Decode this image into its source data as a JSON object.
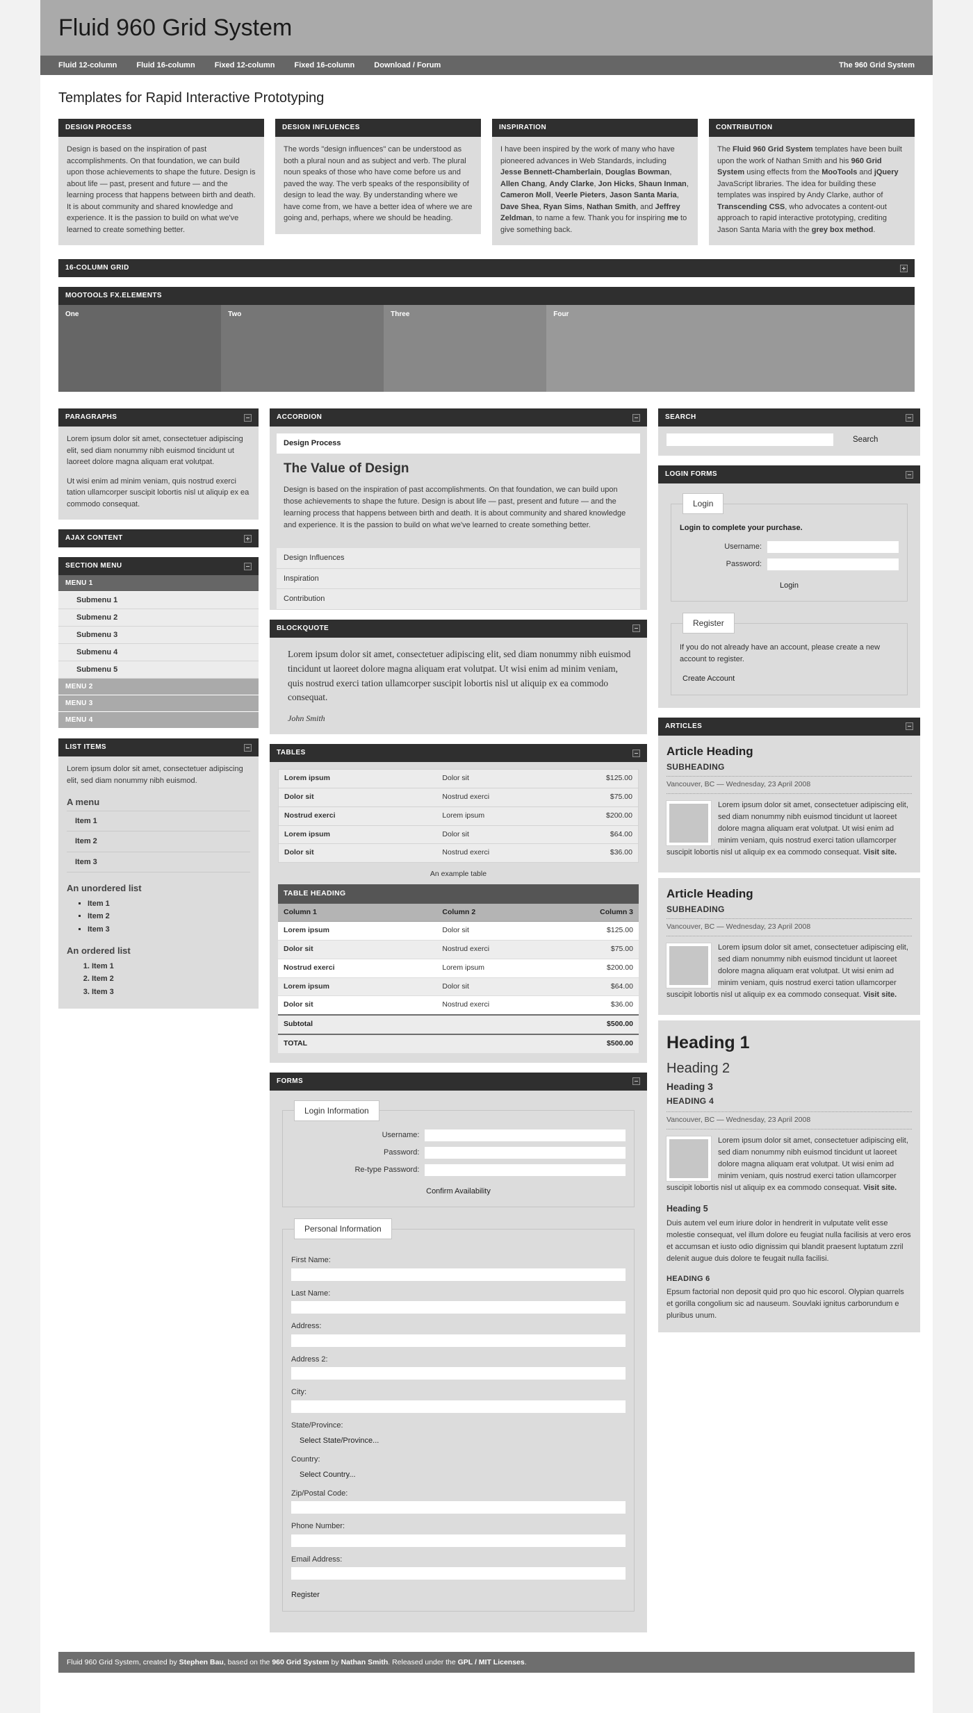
{
  "header": {
    "title": "Fluid 960 Grid System",
    "nav": [
      {
        "label": "Fluid 12-column"
      },
      {
        "label": "Fluid 16-column"
      },
      {
        "label": "Fixed 12-column"
      },
      {
        "label": "Fixed 16-column"
      },
      {
        "label": "Download / Forum"
      }
    ],
    "nav_right": "The 960 Grid System",
    "page_title": "Templates for Rapid Interactive Prototyping"
  },
  "top_boxes": [
    {
      "title": "DESIGN PROCESS",
      "body": "Design is based on the inspiration of past accomplishments. On that foundation, we can build upon those achievements to shape the future. Design is about life — past, present and future — and the learning process that happens between birth and death. It is about community and shared knowledge and experience. It is the passion to build on what we've learned to create something better."
    },
    {
      "title": "DESIGN INFLUENCES",
      "body": "The words \"design influences\" can be understood as both a plural noun and as subject and verb. The plural noun speaks of those who have come before us and paved the way. The verb speaks of the responsibility of design to lead the way. By understanding where we have come from, we have a better idea of where we are going and, perhaps, where we should be heading."
    },
    {
      "title": "INSPIRATION",
      "body_html": "I have been inspired by the work of many who have pioneered advances in Web Standards, including <b>Jesse Bennett-Chamberlain</b>, <b>Douglas Bowman</b>, <b>Allen Chang</b>, <b>Andy Clarke</b>, <b>Jon Hicks</b>, <b>Shaun Inman</b>, <b>Cameron Moll</b>, <b>Veerle Pieters</b>, <b>Jason Santa Maria</b>, <b>Dave Shea</b>, <b>Ryan Sims</b>, <b>Nathan Smith</b>, and <b>Jeffrey Zeldman</b>, to name a few. Thank you for inspiring <b>me</b> to give something back."
    },
    {
      "title": "CONTRIBUTION",
      "body_html": "The <b>Fluid 960 Grid System</b> templates have been built upon the work of Nathan Smith and his <b>960 Grid System</b> using effects from the <b>MooTools</b> and <b>jQuery</b> JavaScript libraries. The idea for building these templates was inspired by Andy Clarke, author of <b>Transcending CSS</b>, who advocates a content-out approach to rapid interactive prototyping, crediting Jason Santa Maria with the <b>grey box method</b>."
    }
  ],
  "grid_section": {
    "title": "16-COLUMN GRID",
    "fx_title": "MOOTOOLS FX.ELEMENTS",
    "bars": [
      "One",
      "Two",
      "Three",
      "Four"
    ]
  },
  "left_column": {
    "paragraphs": {
      "title": "PARAGRAPHS",
      "p1": "Lorem ipsum dolor sit amet, consectetuer adipiscing elit, sed diam nonummy nibh euismod tincidunt ut laoreet dolore magna aliquam erat volutpat.",
      "p2": "Ut wisi enim ad minim veniam, quis nostrud exerci tation ullamcorper suscipit lobortis nisl ut aliquip ex ea commodo consequat."
    },
    "ajax": {
      "title": "AJAX CONTENT"
    },
    "section_menu": {
      "title": "SECTION MENU",
      "menu1": "MENU 1",
      "submenus": [
        "Submenu 1",
        "Submenu 2",
        "Submenu 3",
        "Submenu 4",
        "Submenu 5"
      ],
      "others": [
        "MENU 2",
        "MENU 3",
        "MENU 4"
      ]
    },
    "list_items": {
      "title": "LIST ITEMS",
      "intro": "Lorem ipsum dolor sit amet, consectetuer adipiscing elit, sed diam nonummy nibh euismod.",
      "menu_heading": "A menu",
      "menu": [
        "Item 1",
        "Item 2",
        "Item 3"
      ],
      "ul_heading": "An unordered list",
      "ul": [
        "Item 1",
        "Item 2",
        "Item 3"
      ],
      "ol_heading": "An ordered list",
      "ol": [
        "Item 1",
        "Item 2",
        "Item 3"
      ]
    }
  },
  "mid_column": {
    "accordion": {
      "title": "ACCORDION",
      "open_tab": "Design Process",
      "heading": "The Value of Design",
      "body": "Design is based on the inspiration of past accomplishments. On that foundation, we can build upon those achievements to shape the future. Design is about life — past, present and future — and the learning process that happens between birth and death. It is about community and shared knowledge and experience. It is the passion to build on what we've learned to create something better.",
      "closed_tabs": [
        "Design Influences",
        "Inspiration",
        "Contribution"
      ]
    },
    "blockquote": {
      "title": "BLOCKQUOTE",
      "quote": "Lorem ipsum dolor sit amet, consectetuer adipiscing elit, sed diam nonummy nibh euismod tincidunt ut laoreet dolore magna aliquam erat volutpat. Ut wisi enim ad minim veniam, quis nostrud exerci tation ullamcorper suscipit lobortis nisl ut aliquip ex ea commodo consequat.",
      "cite": "John Smith"
    },
    "tables": {
      "title": "TABLES",
      "plain_rows": [
        [
          "Lorem ipsum",
          "Dolor sit",
          "$125.00"
        ],
        [
          "Dolor sit",
          "Nostrud exerci",
          "$75.00"
        ],
        [
          "Nostrud exerci",
          "Lorem ipsum",
          "$200.00"
        ],
        [
          "Lorem ipsum",
          "Dolor sit",
          "$64.00"
        ],
        [
          "Dolor sit",
          "Nostrud exerci",
          "$36.00"
        ]
      ],
      "caption": "An example table",
      "heading_bar": "TABLE HEADING",
      "columns": [
        "Column 1",
        "Column 2",
        "Column 3"
      ],
      "rows": [
        [
          "Lorem ipsum",
          "Dolor sit",
          "$125.00"
        ],
        [
          "Dolor sit",
          "Nostrud exerci",
          "$75.00"
        ],
        [
          "Nostrud exerci",
          "Lorem ipsum",
          "$200.00"
        ],
        [
          "Lorem ipsum",
          "Dolor sit",
          "$64.00"
        ],
        [
          "Dolor sit",
          "Nostrud exerci",
          "$36.00"
        ]
      ],
      "subtotal_label": "Subtotal",
      "subtotal_value": "$500.00",
      "total_label": "TOTAL",
      "total_value": "$500.00"
    },
    "forms": {
      "title": "FORMS",
      "login_legend": "Login Information",
      "username_label": "Username:",
      "password_label": "Password:",
      "retype_label": "Re-type Password:",
      "confirm_button": "Confirm Availability",
      "personal_legend": "Personal Information",
      "fields": [
        {
          "label": "First Name:",
          "type": "text"
        },
        {
          "label": "Last Name:",
          "type": "text"
        },
        {
          "label": "Address:",
          "type": "text"
        },
        {
          "label": "Address 2:",
          "type": "text"
        },
        {
          "label": "City:",
          "type": "text"
        },
        {
          "label": "State/Province:",
          "type": "select",
          "value": "Select State/Province..."
        },
        {
          "label": "Country:",
          "type": "select",
          "value": "Select Country..."
        },
        {
          "label": "Zip/Postal Code:",
          "type": "text"
        },
        {
          "label": "Phone Number:",
          "type": "text"
        },
        {
          "label": "Email Address:",
          "type": "text"
        }
      ],
      "register_button": "Register"
    }
  },
  "right_column": {
    "search": {
      "title": "SEARCH",
      "value": "",
      "button": "Search"
    },
    "login_forms": {
      "title": "LOGIN FORMS",
      "login_legend": "Login",
      "login_note": "Login to complete your purchase.",
      "username_label": "Username:",
      "password_label": "Password:",
      "login_button": "Login",
      "register_legend": "Register",
      "register_note": "If you do not already have an account, please create a new account to register.",
      "create_button": "Create Account"
    },
    "articles": {
      "title": "ARTICLES",
      "items": [
        {
          "heading": "Article Heading",
          "subheading": "SUBHEADING",
          "dateline": "Vancouver, BC — Wednesday, 23 April 2008",
          "body": "Lorem ipsum dolor sit amet, consectetuer adipiscing elit, sed diam nonummy nibh euismod tincidunt ut laoreet dolore magna aliquam erat volutpat. Ut wisi enim ad minim veniam, quis nostrud exerci tation ullamcorper suscipit lobortis nisl ut aliquip ex ea commodo consequat.",
          "link": "Visit site."
        },
        {
          "heading": "Article Heading",
          "subheading": "SUBHEADING",
          "dateline": "Vancouver, BC — Wednesday, 23 April 2008",
          "body": "Lorem ipsum dolor sit amet, consectetuer adipiscing elit, sed diam nonummy nibh euismod tincidunt ut laoreet dolore magna aliquam erat volutpat. Ut wisi enim ad minim veniam, quis nostrud exerci tation ullamcorper suscipit lobortis nisl ut aliquip ex ea commodo consequat.",
          "link": "Visit site."
        }
      ],
      "headings_demo": {
        "h1": "Heading 1",
        "h2": "Heading 2",
        "h3": "Heading 3",
        "h4": "HEADING 4",
        "dateline": "Vancouver, BC — Wednesday, 23 April 2008",
        "body": "Lorem ipsum dolor sit amet, consectetuer adipiscing elit, sed diam nonummy nibh euismod tincidunt ut laoreet dolore magna aliquam erat volutpat. Ut wisi enim ad minim veniam, quis nostrud exerci tation ullamcorper suscipit lobortis nisl ut aliquip ex ea commodo consequat.",
        "link": "Visit site.",
        "h5": "Heading 5",
        "h5_body": "Duis autem vel eum iriure dolor in hendrerit in vulputate velit esse molestie consequat, vel illum dolore eu feugiat nulla facilisis at vero eros et accumsan et iusto odio dignissim qui blandit praesent luptatum zzril delenit augue duis dolore te feugait nulla facilisi.",
        "h6": "HEADING 6",
        "h6_body": "Epsum factorial non deposit quid pro quo hic escorol. Olypian quarrels et gorilla congolium sic ad nauseum. Souvlaki ignitus carborundum e pluribus unum."
      }
    }
  },
  "footer": {
    "html": "Fluid 960 Grid System, created by <b>Stephen Bau</b>, based on the <b>960 Grid System</b> by <b>Nathan Smith</b>. Released under the <b>GPL / MIT Licenses</b>."
  }
}
